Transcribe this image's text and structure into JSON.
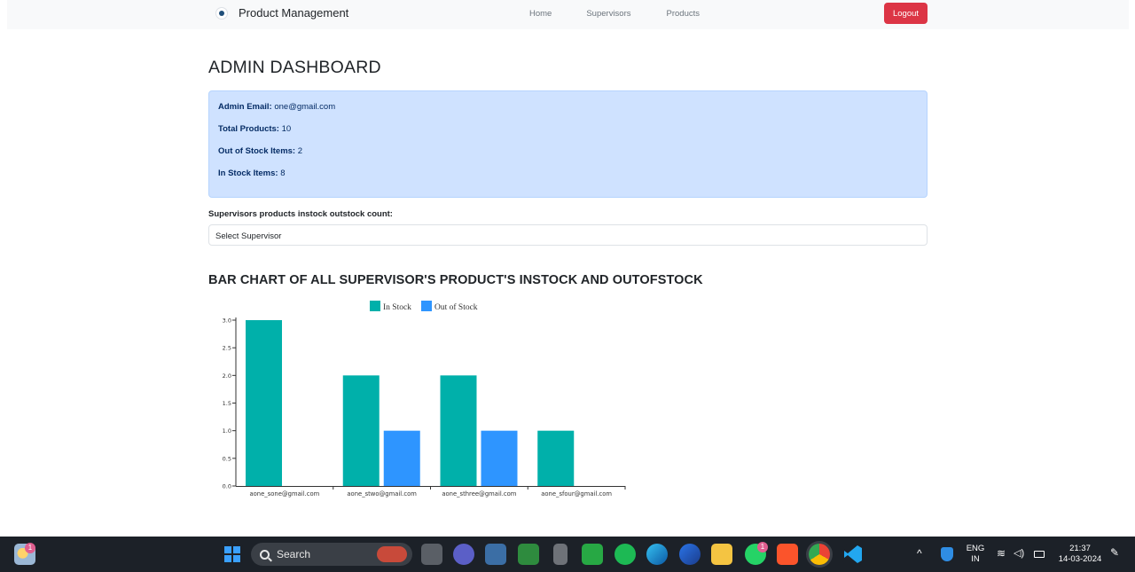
{
  "navbar": {
    "brand": "Product Management",
    "links": [
      "Home",
      "Supervisors",
      "Products"
    ],
    "logout_label": "Logout"
  },
  "page_title": "ADMIN DASHBOARD",
  "info": {
    "email_label": "Admin Email:",
    "email_value": "one@gmail.com",
    "total_label": "Total Products:",
    "total_value": "10",
    "out_label": "Out of Stock Items:",
    "out_value": "2",
    "in_label": "In Stock Items:",
    "in_value": "8"
  },
  "supervisor_section": {
    "label": "Supervisors products instock outstock count:",
    "select_value": "Select Supervisor"
  },
  "chart_heading": "BAR CHART OF ALL SUPERVISOR'S PRODUCT'S INSTOCK AND OUTOFSTOCK",
  "chart_data": {
    "type": "bar",
    "categories": [
      "aone_sone@gmail.com",
      "aone_stwo@gmail.com",
      "aone_sthree@gmail.com",
      "aone_sfour@gmail.com"
    ],
    "series": [
      {
        "name": "In Stock",
        "values": [
          3,
          2,
          2,
          1
        ],
        "color": "#00b0aa"
      },
      {
        "name": "Out of Stock",
        "values": [
          0,
          1,
          1,
          0
        ],
        "color": "#2e95ff"
      }
    ],
    "ylim": [
      0,
      3
    ],
    "yticks": [
      "0.0",
      "0.5",
      "1.0",
      "1.5",
      "2.0",
      "2.5",
      "3.0"
    ],
    "legend": "top-center",
    "grid": false
  },
  "taskbar": {
    "search_label": "Search",
    "lang_line1": "ENG",
    "lang_line2": "IN",
    "time": "21:37",
    "date": "14-03-2024",
    "weather_badge": "1",
    "whatsapp_badge": "1",
    "icons": [
      "weather-icon",
      "windows-start-icon",
      "search-icon",
      "task-view-icon",
      "teams-icon",
      "photos-icon",
      "stock-app-icon",
      "microphone-app-icon",
      "chat-app-icon",
      "spotify-icon",
      "edge-icon",
      "firefox-icon",
      "file-explorer-icon",
      "whatsapp-icon",
      "brave-icon",
      "chrome-icon",
      "vscode-icon",
      "chevron-up-icon",
      "security-icon",
      "wifi-icon",
      "volume-icon",
      "battery-icon",
      "pen-icon"
    ]
  }
}
